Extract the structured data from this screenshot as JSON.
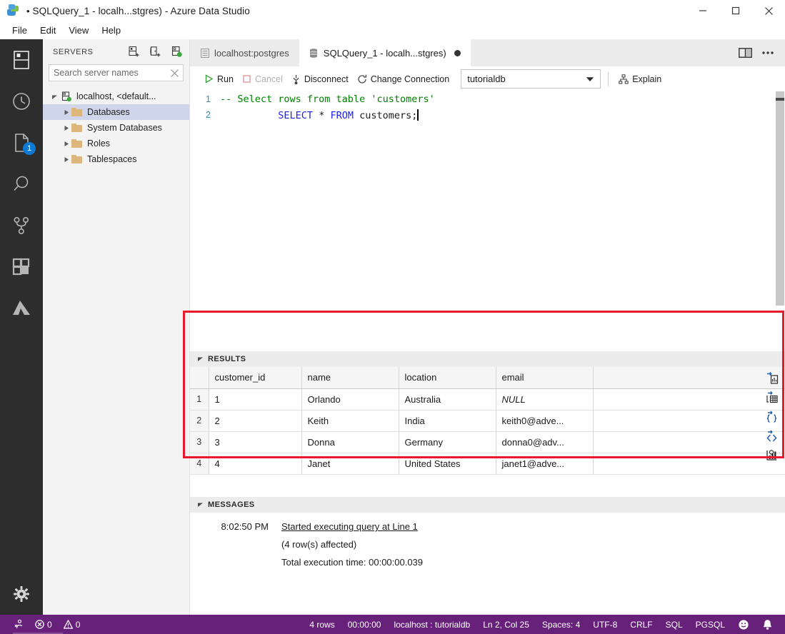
{
  "window": {
    "title": "SQLQuery_1 - localh...stgres) - Azure Data Studio",
    "dirty_marker": "•",
    "minimize_label": "Minimize",
    "maximize_label": "Maximize",
    "close_label": "Close"
  },
  "menubar": {
    "items": [
      {
        "label": "File"
      },
      {
        "label": "Edit"
      },
      {
        "label": "View"
      },
      {
        "label": "Help"
      }
    ]
  },
  "activitybar": {
    "items": [
      {
        "name": "servers-icon",
        "title": "Servers"
      },
      {
        "name": "history-icon",
        "title": "Query History"
      },
      {
        "name": "notebooks-icon",
        "title": "Notebooks",
        "badge": "1"
      },
      {
        "name": "search-icon",
        "title": "Search"
      },
      {
        "name": "source-control-icon",
        "title": "Source Control"
      },
      {
        "name": "extensions-icon",
        "title": "Extensions"
      },
      {
        "name": "azure-icon",
        "title": "Azure"
      }
    ],
    "bottom": [
      {
        "name": "gear-icon",
        "title": "Manage"
      }
    ]
  },
  "sidebar": {
    "title": "SERVERS",
    "actions": [
      {
        "name": "new-connection-icon",
        "title": "New Connection"
      },
      {
        "name": "new-server-group-icon",
        "title": "New Server Group"
      },
      {
        "name": "active-connections-icon",
        "title": "Show Active Connections"
      }
    ],
    "search": {
      "placeholder": "Search server names",
      "value": "",
      "clear_label": "Clear"
    },
    "tree": [
      {
        "label": "localhost, <default...",
        "type": "server",
        "expanded": true,
        "selected": false,
        "indent": 0
      },
      {
        "label": "Databases",
        "type": "folder",
        "expanded": false,
        "selected": true,
        "indent": 1
      },
      {
        "label": "System Databases",
        "type": "folder",
        "expanded": false,
        "selected": false,
        "indent": 1
      },
      {
        "label": "Roles",
        "type": "folder",
        "expanded": false,
        "selected": false,
        "indent": 1
      },
      {
        "label": "Tablespaces",
        "type": "folder",
        "expanded": false,
        "selected": false,
        "indent": 1
      }
    ]
  },
  "tabs": [
    {
      "label": "localhost:postgres",
      "active": false,
      "dirty": false
    },
    {
      "label": "SQLQuery_1 - localh...stgres)",
      "active": true,
      "dirty": true
    }
  ],
  "tabbar_actions": [
    {
      "name": "split-editor-icon",
      "title": "Split Editor"
    },
    {
      "name": "more-actions-icon",
      "title": "More Actions...",
      "glyph": "•••"
    }
  ],
  "query_toolbar": {
    "run_label": "Run",
    "cancel_label": "Cancel",
    "disconnect_label": "Disconnect",
    "change_connection_label": "Change Connection",
    "database_value": "tutorialdb",
    "explain_label": "Explain"
  },
  "editor": {
    "lines": [
      {
        "number": "1",
        "tokens": [
          {
            "text": "-- Select rows from table 'customers'",
            "style": "comment"
          }
        ]
      },
      {
        "number": "2",
        "tokens": [
          {
            "text": "SELECT",
            "style": "keyword"
          },
          {
            "text": " * ",
            "style": "plain"
          },
          {
            "text": "FROM",
            "style": "keyword"
          },
          {
            "text": " customers;",
            "style": "plain"
          }
        ]
      }
    ],
    "line1_text": "-- Select rows from table 'customers'",
    "line1_num": "1",
    "line2_num": "2",
    "line2_kw1": "SELECT",
    "line2_star": " * ",
    "line2_kw2": "FROM",
    "line2_rest": " customers;"
  },
  "results": {
    "panel_title": "RESULTS",
    "columns": [
      "customer_id",
      "name",
      "location",
      "email"
    ],
    "rows": [
      {
        "num": "1",
        "customer_id": "1",
        "name": "Orlando",
        "location": "Australia",
        "email": "NULL",
        "email_is_null": true
      },
      {
        "num": "2",
        "customer_id": "2",
        "name": "Keith",
        "location": "India",
        "email": "keith0@adve...",
        "email_is_null": false
      },
      {
        "num": "3",
        "customer_id": "3",
        "name": "Donna",
        "location": "Germany",
        "email": "donna0@adv...",
        "email_is_null": false
      },
      {
        "num": "4",
        "customer_id": "4",
        "name": "Janet",
        "location": "United States",
        "email": "janet1@adve...",
        "email_is_null": false
      }
    ],
    "export_actions": [
      {
        "name": "save-as-csv-icon",
        "title": "Save As CSV"
      },
      {
        "name": "save-as-excel-icon",
        "title": "Save As Excel"
      },
      {
        "name": "save-as-json-icon",
        "title": "Save As JSON"
      },
      {
        "name": "save-as-xml-icon",
        "title": "Save As XML"
      },
      {
        "name": "chart-icon",
        "title": "Chart"
      }
    ],
    "highlight_color": "#e8192c"
  },
  "messages": {
    "panel_title": "MESSAGES",
    "entries": [
      {
        "time": "8:02:50 PM",
        "text": "Started executing query at Line 1",
        "link": true
      },
      {
        "time": "",
        "text": "(4 row(s) affected)",
        "link": false
      },
      {
        "time": "",
        "text": "Total execution time: 00:00:00.039",
        "link": false
      }
    ]
  },
  "statusbar": {
    "background": "#68217a",
    "left": [
      {
        "name": "remote-icon",
        "label": ""
      },
      {
        "name": "error-count",
        "label": "0",
        "icon": "error-icon"
      },
      {
        "name": "warning-count",
        "label": "0",
        "icon": "warning-icon"
      }
    ],
    "right": [
      {
        "name": "row-count",
        "label": "4 rows"
      },
      {
        "name": "execution-time",
        "label": "00:00:00"
      },
      {
        "name": "connection-info",
        "label": "localhost : tutorialdb"
      },
      {
        "name": "cursor-position",
        "label": "Ln 2, Col 25"
      },
      {
        "name": "indentation",
        "label": "Spaces: 4"
      },
      {
        "name": "encoding",
        "label": "UTF-8"
      },
      {
        "name": "eol",
        "label": "CRLF"
      },
      {
        "name": "language-mode",
        "label": "SQL"
      },
      {
        "name": "provider",
        "label": "PGSQL"
      },
      {
        "name": "feedback-icon",
        "label": ""
      },
      {
        "name": "notifications-bell-icon",
        "label": ""
      }
    ]
  }
}
